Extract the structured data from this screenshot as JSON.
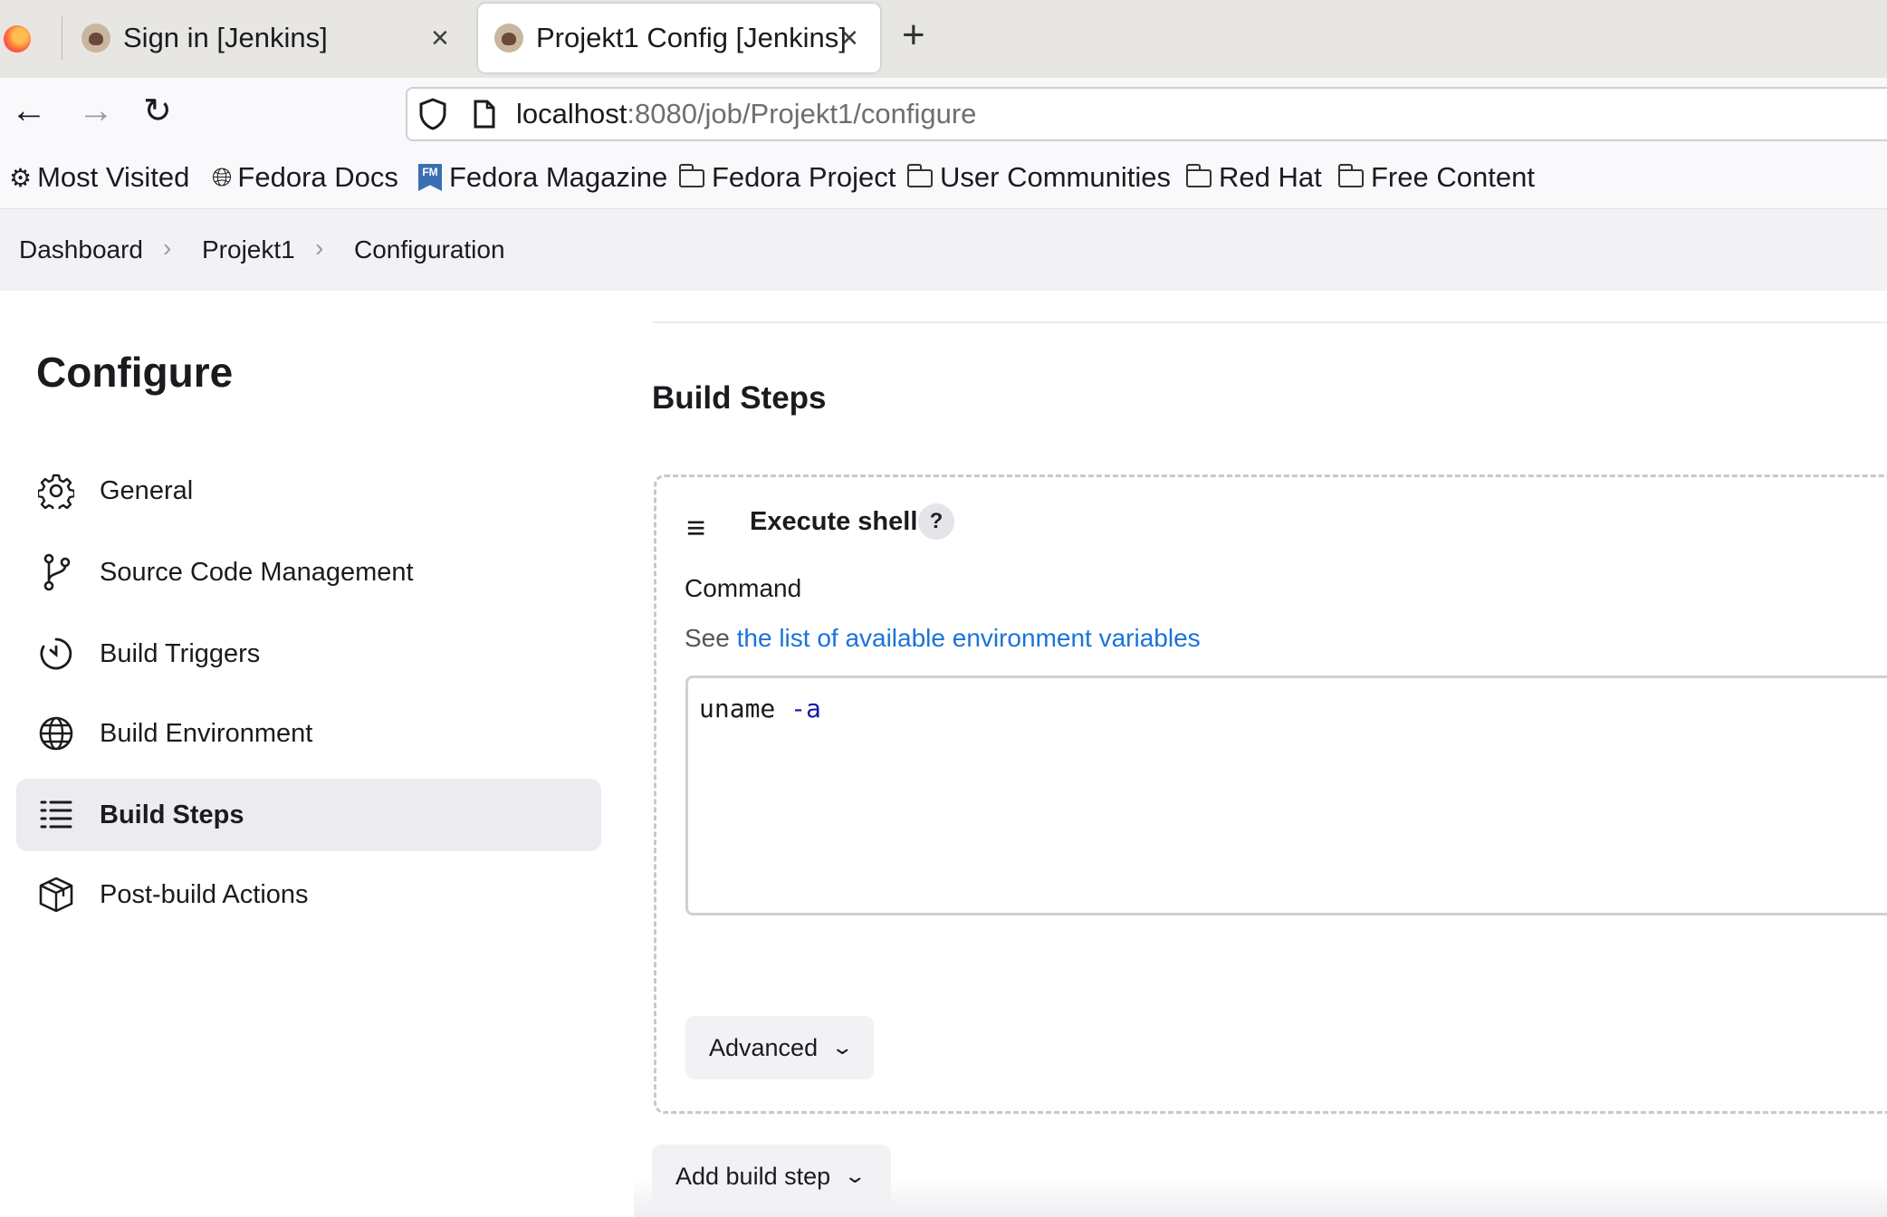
{
  "browser": {
    "tabs": [
      {
        "title": "Sign in [Jenkins]",
        "active": false
      },
      {
        "title": "Projekt1 Config [Jenkins]",
        "active": true
      }
    ],
    "url_host": "localhost",
    "url_rest": ":8080/job/Projekt1/configure",
    "bookmarks": [
      "Most Visited",
      "Fedora Docs",
      "Fedora Magazine",
      "Fedora Project",
      "User Communities",
      "Red Hat",
      "Free Content"
    ],
    "fm_badge": "FM"
  },
  "breadcrumb": [
    "Dashboard",
    "Projekt1",
    "Configuration"
  ],
  "sidebar": {
    "title": "Configure",
    "items": [
      {
        "label": "General",
        "icon": "gear-icon"
      },
      {
        "label": "Source Code Management",
        "icon": "branch-icon"
      },
      {
        "label": "Build Triggers",
        "icon": "clock-icon"
      },
      {
        "label": "Build Environment",
        "icon": "globe-icon"
      },
      {
        "label": "Build Steps",
        "icon": "list-icon",
        "active": true
      },
      {
        "label": "Post-build Actions",
        "icon": "package-icon"
      }
    ]
  },
  "main": {
    "section_title": "Build Steps",
    "step": {
      "title": "Execute shell",
      "help": "?",
      "command_label": "Command",
      "env_prefix": "See ",
      "env_link": "the list of available environment variables",
      "command_cmd": "uname",
      "command_flag": "-a",
      "advanced_label": "Advanced"
    },
    "add_step_label": "Add build step"
  },
  "colors": {
    "link": "#1a73d9",
    "active_bg": "#ebebf0",
    "button_bg": "#f2f2f5"
  }
}
